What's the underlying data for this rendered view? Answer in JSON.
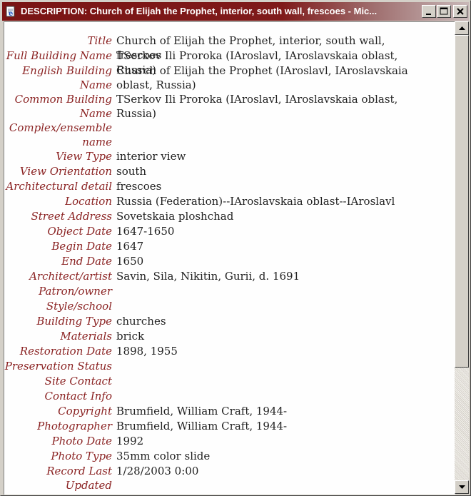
{
  "window": {
    "title": "DESCRIPTION: Church of Elijah the Prophet, interior, south wall, frescoes - Mic...",
    "icons": {
      "app": "ie-page-icon",
      "minimize": "minimize-icon",
      "maximize": "maximize-icon",
      "close": "close-icon"
    }
  },
  "fields": [
    {
      "label": "Title",
      "value": "Church of Elijah the Prophet, interior, south wall, frescoes"
    },
    {
      "label": "Full Building Name",
      "value": "TSerkov Ili Proroka (IAroslavl, IAroslavskaia oblast, Russia)"
    },
    {
      "label": "English Building Name",
      "value": "Church of Elijah the Prophet (IAroslavl, IAroslavskaia oblast, Russia)"
    },
    {
      "label": "Common Building Name",
      "value": "TSerkov Ili Proroka (IAroslavl, IAroslavskaia oblast, Russia)"
    },
    {
      "label": "Complex/ensemble name",
      "value": ""
    },
    {
      "label": "View Type",
      "value": "interior view"
    },
    {
      "label": "View Orientation",
      "value": "south"
    },
    {
      "label": "Architectural detail",
      "value": "frescoes"
    },
    {
      "label": "Location",
      "value": "Russia (Federation)--IAroslavskaia oblast--IAroslavl"
    },
    {
      "label": "Street Address",
      "value": "Sovetskaia ploshchad"
    },
    {
      "label": "Object Date",
      "value": "1647-1650"
    },
    {
      "label": "Begin Date",
      "value": "1647"
    },
    {
      "label": "End Date",
      "value": "1650"
    },
    {
      "label": "Architect/artist",
      "value": "Savin, Sila, Nikitin, Gurii, d. 1691"
    },
    {
      "label": "Patron/owner",
      "value": ""
    },
    {
      "label": "Style/school",
      "value": ""
    },
    {
      "label": "Building Type",
      "value": "churches"
    },
    {
      "label": "Materials",
      "value": "brick"
    },
    {
      "label": "Restoration Date",
      "value": "1898, 1955"
    },
    {
      "label": "Preservation Status",
      "value": ""
    },
    {
      "label": "Site Contact",
      "value": ""
    },
    {
      "label": "Contact Info",
      "value": ""
    },
    {
      "label": "Copyright",
      "value": "Brumfield, William Craft, 1944-"
    },
    {
      "label": "Photographer",
      "value": "Brumfield, William Craft, 1944-"
    },
    {
      "label": "Photo Date",
      "value": "1992"
    },
    {
      "label": "Photo Type",
      "value": "35mm color slide"
    },
    {
      "label": "Record Last Updated",
      "value": "1/28/2003 0:00"
    }
  ],
  "scrollbar": {
    "icons": {
      "up": "scroll-up-arrow-icon",
      "down": "scroll-down-arrow-icon"
    }
  }
}
